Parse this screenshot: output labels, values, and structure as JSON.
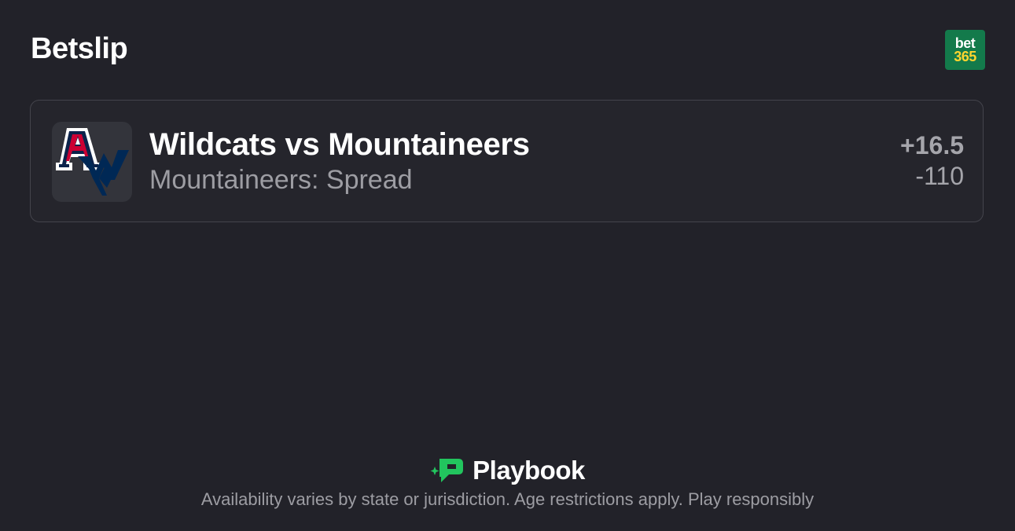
{
  "header": {
    "title": "Betslip",
    "sportsbook_logo": {
      "line1": "bet",
      "line2": "365",
      "bg_color": "#137a4b",
      "accent_color": "#ffd52e"
    }
  },
  "bet": {
    "matchup": "Wildcats vs Mountaineers",
    "market": "Mountaineers: Spread",
    "line": "+16.5",
    "price": "-110",
    "logos": [
      "arizona-wildcats-logo",
      "west-virginia-mountaineers-logo"
    ]
  },
  "footer": {
    "brand": "Playbook",
    "brand_color": "#22c55e",
    "disclaimer": "Availability varies by state or jurisdiction. Age restrictions apply. Play responsibly"
  }
}
